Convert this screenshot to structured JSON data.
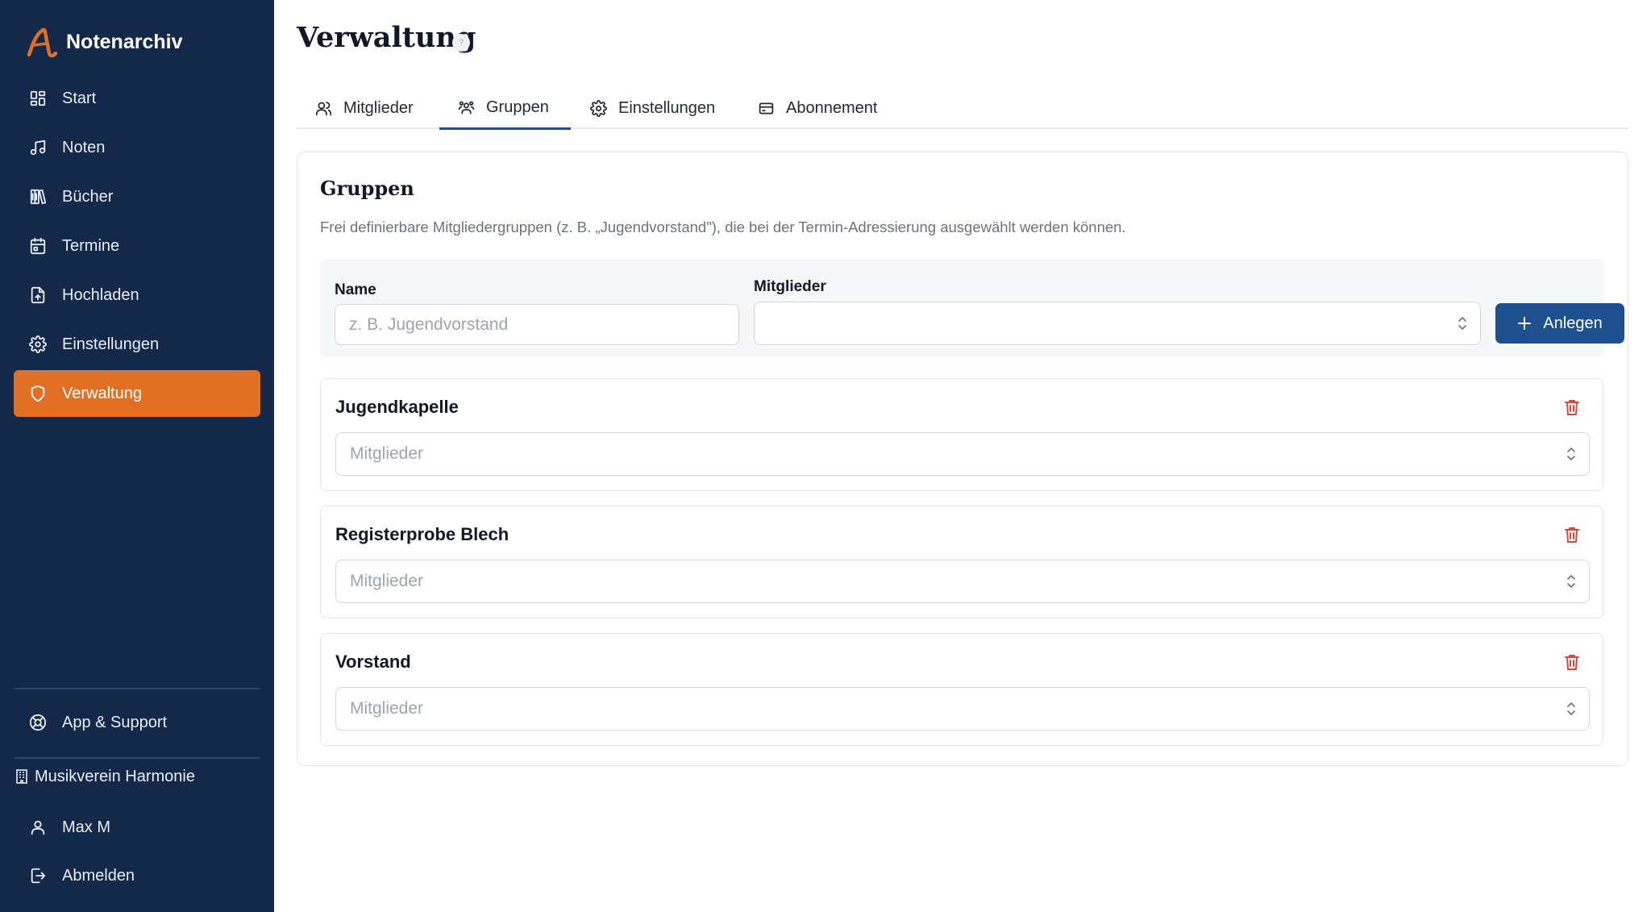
{
  "app": {
    "name": "Notenarchiv",
    "accent": "#e17024",
    "sidebar_bg": "#14284a",
    "primary": "#1e4f8f",
    "danger": "#e0453a"
  },
  "sidebar": {
    "items": [
      {
        "label": "Start",
        "icon": "dashboard-icon"
      },
      {
        "label": "Noten",
        "icon": "music-note-icon"
      },
      {
        "label": "Bücher",
        "icon": "library-icon"
      },
      {
        "label": "Termine",
        "icon": "calendar-icon"
      },
      {
        "label": "Hochladen",
        "icon": "file-upload-icon"
      },
      {
        "label": "Einstellungen",
        "icon": "gear-icon"
      },
      {
        "label": "Verwaltung",
        "icon": "shield-icon",
        "active": true
      }
    ],
    "support": "App & Support",
    "organization": "Musikverein Harmonie",
    "user": "Max M",
    "logout": "Abmelden"
  },
  "page": {
    "title": "Verwaltung",
    "help": "?"
  },
  "tabs": [
    {
      "label": "Mitglieder",
      "icon": "users-icon"
    },
    {
      "label": "Gruppen",
      "icon": "group-icon",
      "active": true
    },
    {
      "label": "Einstellungen",
      "icon": "gear-icon"
    },
    {
      "label": "Abonnement",
      "icon": "credit-card-icon"
    }
  ],
  "groups_section": {
    "title": "Gruppen",
    "description": "Frei definierbare Mitgliedergruppen (z. B. „Jugendvorstand\"), die bei der Termin-Adressierung ausgewählt werden können.",
    "form": {
      "name_label": "Name",
      "name_placeholder": "z. B. Jugendvorstand",
      "members_label": "Mitglieder",
      "members_value": "",
      "submit_label": "Anlegen"
    },
    "groups": [
      {
        "name": "Jugendkapelle",
        "members_placeholder": "Mitglieder"
      },
      {
        "name": "Registerprobe Blech",
        "members_placeholder": "Mitglieder"
      },
      {
        "name": "Vorstand",
        "members_placeholder": "Mitglieder"
      }
    ]
  }
}
